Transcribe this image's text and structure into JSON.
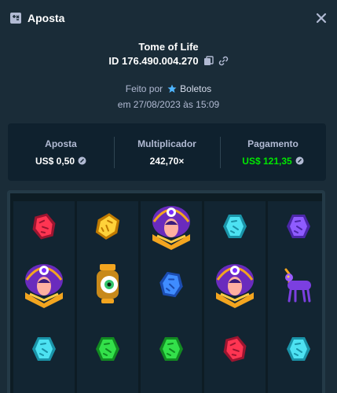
{
  "header": {
    "title": "Aposta",
    "title_icon": "bet-slip-icon",
    "close_icon": "close-icon"
  },
  "game": {
    "name": "Tome of Life",
    "bet_id": "ID 176.490.004.270",
    "copy_icon": "copy-icon",
    "link_icon": "link-icon"
  },
  "author": {
    "prefix": "Feito por",
    "user": "Boletos",
    "badge_icon": "star-badge-icon"
  },
  "date": "em 27/08/2023 às 15:09",
  "stats": {
    "bet_label": "Aposta",
    "bet_value": "US$ 0,50",
    "multiplier_label": "Multiplicador",
    "multiplier_value": "242,70×",
    "payout_label": "Pagamento",
    "payout_value": "US$ 121,35",
    "coin_icon": "coin-icon"
  },
  "colors": {
    "background": "#1a2c38",
    "panel": "#0f212e",
    "payout_green": "#00e701",
    "muted_text": "#b1bad3"
  },
  "reels": [
    [
      "red-gem",
      "tome-of-life-wild",
      "cyan-gem"
    ],
    [
      "yellow-gem",
      "eye-lantern",
      "green-gem"
    ],
    [
      "tome-of-life-wild",
      "blue-gem",
      "green-gem"
    ],
    [
      "cyan-gem",
      "tome-of-life-wild",
      "red-gem"
    ],
    [
      "purple-gem",
      "purple-beast",
      "cyan-gem"
    ]
  ]
}
